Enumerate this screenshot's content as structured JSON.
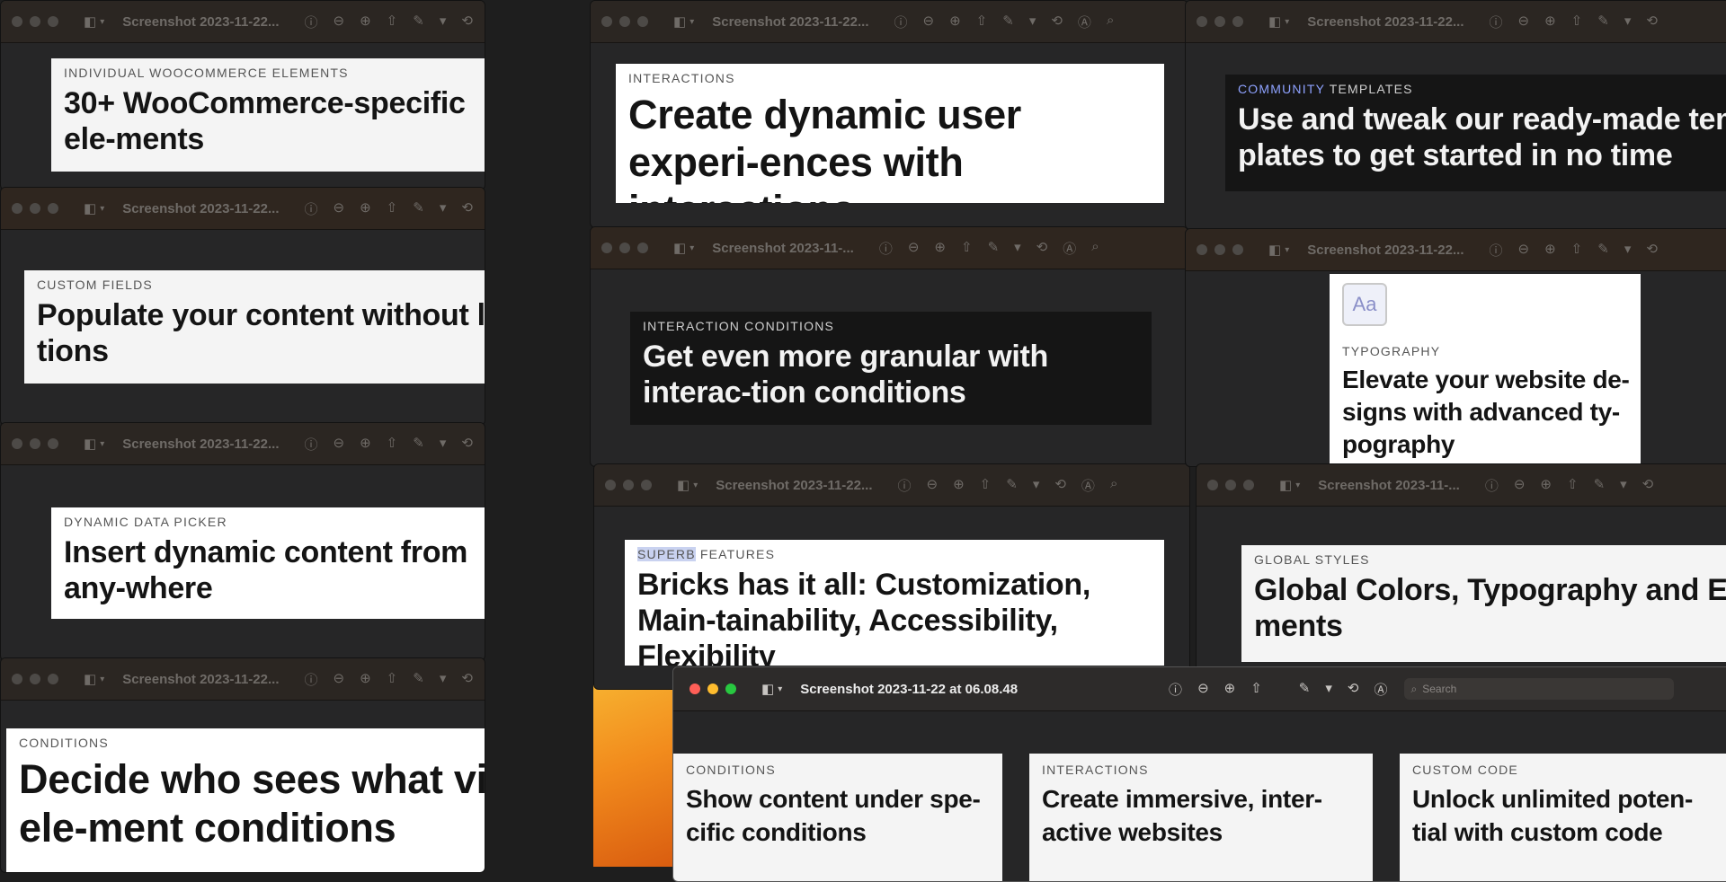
{
  "windows": [
    {
      "id": "w1",
      "title": "Screenshot 2023-11-22...",
      "eyebrow": "INDIVIDUAL WOOCOMMERCE ELEMENTS",
      "heading": "30+ WooCommerce-specific ele-ments"
    },
    {
      "id": "w2",
      "title": "Screenshot 2023-11-22...",
      "eyebrow": "CUSTOM FIELDS",
      "heading": "Populate your content without limita-tions"
    },
    {
      "id": "w3",
      "title": "Screenshot 2023-11-22...",
      "eyebrow": "DYNAMIC DATA PICKER",
      "heading": "Insert dynamic content from any-where"
    },
    {
      "id": "w4",
      "title": "Screenshot 2023-11-22...",
      "eyebrow": "CONDITIONS",
      "heading": "Decide who sees what via ele-ment conditions"
    },
    {
      "id": "w5",
      "title": "Screenshot 2023-11-22...",
      "eyebrow": "INTERACTIONS",
      "heading": "Create dynamic user experi-ences with interactions"
    },
    {
      "id": "w6",
      "title": "Screenshot 2023-11-...",
      "eyebrow": "INTERACTION CONDITIONS",
      "heading": "Get even more granular with interac-tion conditions"
    },
    {
      "id": "w7",
      "title": "Screenshot 2023-11-22...",
      "eyebrow_highlight": "SUPERB",
      "eyebrow_rest": " FEATURES",
      "heading": "Bricks has it all: Customization, Main-tainability, Accessibility, Flexibility"
    },
    {
      "id": "w8",
      "title": "Screenshot 2023-11-22...",
      "eyebrow_accent": "COMMUNITY",
      "eyebrow_rest": " TEMPLATES",
      "heading": "Use and tweak our ready-made tem-plates to get started in no time"
    },
    {
      "id": "w9",
      "title": "Screenshot 2023-11-22...",
      "icon_text": "Aa",
      "eyebrow": "TYPOGRAPHY",
      "heading": "Elevate your website de-signs with advanced ty-pography"
    },
    {
      "id": "w10",
      "title": "Screenshot 2023-11-...",
      "eyebrow": "GLOBAL STYLES",
      "heading": "Global Colors, Typography and Ele-ments"
    }
  ],
  "active_window": {
    "title": "Screenshot 2023-11-22 at 06.08.48",
    "search_placeholder": "Search",
    "panels": [
      {
        "eyebrow": "CONDITIONS",
        "heading": "Show content under spe-cific conditions"
      },
      {
        "eyebrow": "INTERACTIONS",
        "heading": "Create immersive, inter-active websites"
      },
      {
        "eyebrow": "CUSTOM CODE",
        "heading": "Unlock unlimited poten-tial with custom code"
      }
    ]
  },
  "toolbar_icons": [
    "sidebar-icon",
    "chevron-down-icon",
    "info-icon",
    "zoom-out-icon",
    "zoom-in-icon",
    "share-icon",
    "markup-icon",
    "chevron-down-icon",
    "rotate-icon",
    "annotate-icon",
    "search-icon"
  ],
  "colors": {
    "wallpaper": "#f28c1d",
    "accent_blue": "#8ea2ff",
    "highlight": "#c9d2f0"
  }
}
